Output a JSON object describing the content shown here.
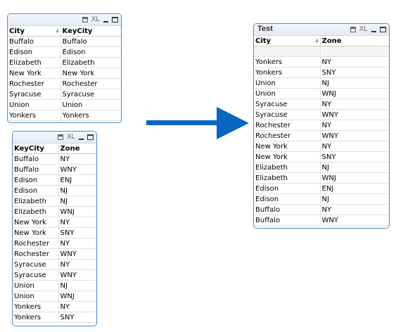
{
  "box1": {
    "headers": [
      "City",
      "KeyCity"
    ],
    "rows": [
      [
        "Buffalo",
        "Buffalo"
      ],
      [
        "Edison",
        "Edison"
      ],
      [
        "Elizabeth",
        "Elizabeth"
      ],
      [
        "New York",
        "New York"
      ],
      [
        "Rochester",
        "Rochester"
      ],
      [
        "Syracuse",
        "Syracuse"
      ],
      [
        "Union",
        "Union"
      ],
      [
        "Yonkers",
        "Yonkers"
      ]
    ]
  },
  "box2": {
    "headers": [
      "KeyCity",
      "Zone"
    ],
    "rows": [
      [
        "Buffalo",
        "NY"
      ],
      [
        "Buffalo",
        "WNY"
      ],
      [
        "Edison",
        "ENJ"
      ],
      [
        "Edison",
        "NJ"
      ],
      [
        "Elizabeth",
        "NJ"
      ],
      [
        "Elizabeth",
        "WNJ"
      ],
      [
        "New York",
        "NY"
      ],
      [
        "New York",
        "SNY"
      ],
      [
        "Rochester",
        "NY"
      ],
      [
        "Rochester",
        "WNY"
      ],
      [
        "Syracuse",
        "NY"
      ],
      [
        "Syracuse",
        "WNY"
      ],
      [
        "Union",
        "NJ"
      ],
      [
        "Union",
        "WNJ"
      ],
      [
        "Yonkers",
        "NY"
      ],
      [
        "Yonkers",
        "SNY"
      ]
    ]
  },
  "box3": {
    "title": "Test",
    "headers": [
      "City",
      "Zone"
    ],
    "rows": [
      [
        "Yonkers",
        "NY"
      ],
      [
        "Yonkers",
        "SNY"
      ],
      [
        "Union",
        "NJ"
      ],
      [
        "Union",
        "WNJ"
      ],
      [
        "Syracuse",
        "NY"
      ],
      [
        "Syracuse",
        "WNY"
      ],
      [
        "Rochester",
        "NY"
      ],
      [
        "Rochester",
        "WNY"
      ],
      [
        "New York",
        "NY"
      ],
      [
        "New York",
        "SNY"
      ],
      [
        "Elizabeth",
        "NJ"
      ],
      [
        "Elizabeth",
        "WNJ"
      ],
      [
        "Edison",
        "ENJ"
      ],
      [
        "Edison",
        "NJ"
      ],
      [
        "Buffalo",
        "NY"
      ],
      [
        "Buffalo",
        "WNY"
      ]
    ]
  },
  "caption_icons": {
    "print": "print-icon",
    "xl": "XL",
    "minimize": "minimize-icon",
    "maximize": "maximize-icon"
  },
  "colors": {
    "border": "#4a8cc4",
    "arrow": "#0a66c2"
  }
}
